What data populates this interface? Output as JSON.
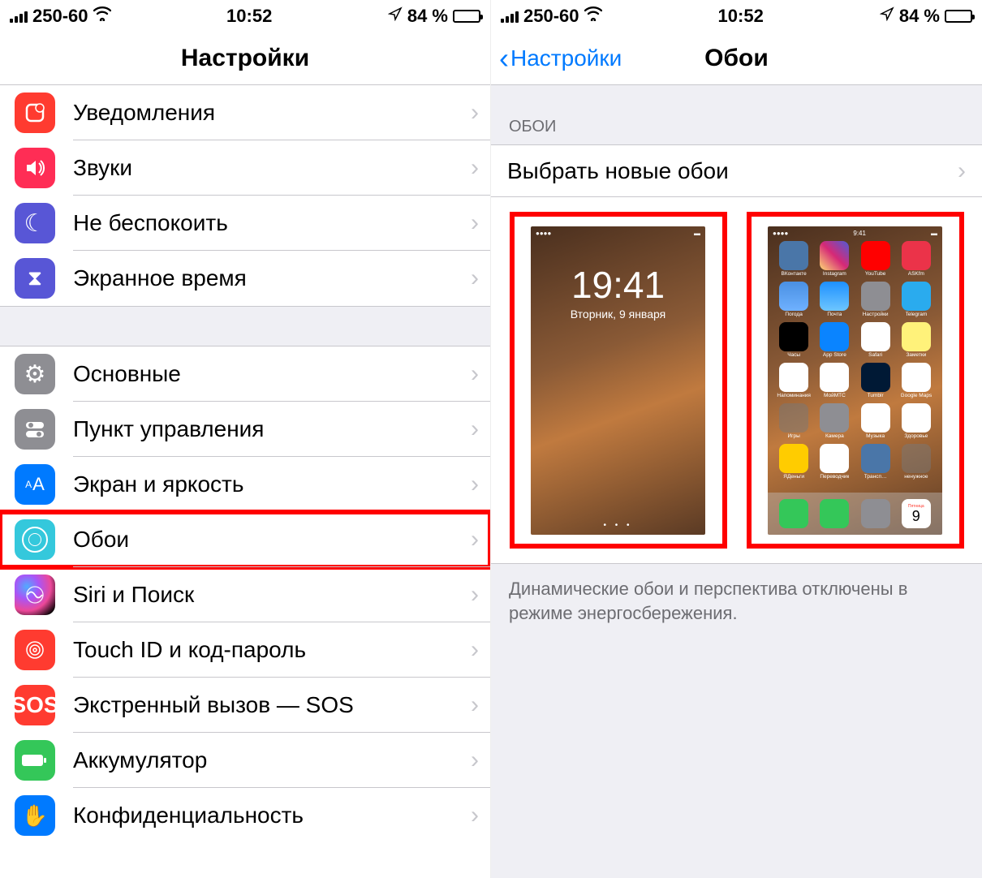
{
  "status": {
    "carrier": "250-60",
    "time": "10:52",
    "battery_pct": "84 %"
  },
  "left": {
    "title": "Настройки",
    "items": [
      {
        "key": "notifications",
        "label": "Уведомления",
        "icon": "notification-icon",
        "color": "ic-red"
      },
      {
        "key": "sounds",
        "label": "Звуки",
        "icon": "speaker-icon",
        "color": "ic-pink"
      },
      {
        "key": "dnd",
        "label": "Не беспокоить",
        "icon": "moon-icon",
        "color": "ic-purple"
      },
      {
        "key": "screentime",
        "label": "Экранное время",
        "icon": "hourglass-icon",
        "color": "ic-purple"
      }
    ],
    "items2": [
      {
        "key": "general",
        "label": "Основные",
        "icon": "gear-icon",
        "color": "ic-gray"
      },
      {
        "key": "controlcenter",
        "label": "Пункт управления",
        "icon": "switches-icon",
        "color": "ic-gray"
      },
      {
        "key": "display",
        "label": "Экран и яркость",
        "icon": "text-size-icon",
        "color": "ic-blue"
      },
      {
        "key": "wallpaper",
        "label": "Обои",
        "icon": "flower-icon",
        "color": "ic-cyan",
        "highlight": true
      },
      {
        "key": "siri",
        "label": "Siri и Поиск",
        "icon": "siri-icon",
        "color": "ic-siri"
      },
      {
        "key": "touchid",
        "label": "Touch ID и код-пароль",
        "icon": "fingerprint-icon",
        "color": "ic-red"
      },
      {
        "key": "sos",
        "label": "Экстренный вызов — SOS",
        "icon": "sos-icon",
        "color": "ic-sos"
      },
      {
        "key": "battery",
        "label": "Аккумулятор",
        "icon": "battery-icon",
        "color": "ic-green"
      },
      {
        "key": "privacy",
        "label": "Конфиденциальность",
        "icon": "hand-icon",
        "color": "ic-blue"
      }
    ]
  },
  "right": {
    "back_label": "Настройки",
    "title": "Обои",
    "section_header": "ОБОИ",
    "choose_new": "Выбрать новые обои",
    "footnote": "Динамические обои и перспектива отключены в режиме энергосбережения.",
    "lock_preview": {
      "time": "19:41",
      "date": "Вторник, 9 января"
    },
    "home_preview": {
      "apps": [
        {
          "label": "ВКонтакте",
          "bg": "#4a76a8"
        },
        {
          "label": "Instagram",
          "bg": "linear-gradient(45deg,#feda75,#d62976,#4f5bd5)"
        },
        {
          "label": "YouTube",
          "bg": "#ff0000"
        },
        {
          "label": "ASKfm",
          "bg": "#eb3349"
        },
        {
          "label": "Погода",
          "bg": "linear-gradient(#4a90e2,#6fb1ff)"
        },
        {
          "label": "Почта",
          "bg": "linear-gradient(#1e90ff,#6ec6ff)"
        },
        {
          "label": "Настройки",
          "bg": "#8e8e93"
        },
        {
          "label": "Telegram",
          "bg": "#2aabee"
        },
        {
          "label": "Часы",
          "bg": "#000"
        },
        {
          "label": "App Store",
          "bg": "#0a84ff"
        },
        {
          "label": "Safari",
          "bg": "#fff"
        },
        {
          "label": "Заметки",
          "bg": "#fff27a"
        },
        {
          "label": "Напоминания",
          "bg": "#fff"
        },
        {
          "label": "МойМТС",
          "bg": "#fff"
        },
        {
          "label": "Tumblr",
          "bg": "#001935"
        },
        {
          "label": "Google Maps",
          "bg": "#fff"
        },
        {
          "label": "Игры",
          "bg": "rgba(120,120,120,.5)"
        },
        {
          "label": "Камера",
          "bg": "#8e8e93"
        },
        {
          "label": "Музыка",
          "bg": "#fff"
        },
        {
          "label": "Здоровье",
          "bg": "#fff"
        },
        {
          "label": "ЯДеньги",
          "bg": "#ffcc00"
        },
        {
          "label": "Переводчик",
          "bg": "#fff"
        },
        {
          "label": "Трансп…",
          "bg": "#4a76a8"
        },
        {
          "label": "ненужное",
          "bg": "rgba(120,120,120,.5)"
        }
      ],
      "dock": [
        {
          "name": "phone",
          "bg": "#34c759"
        },
        {
          "name": "messages",
          "bg": "#34c759"
        },
        {
          "name": "camera",
          "bg": "#8e8e93"
        },
        {
          "name": "calendar",
          "bg": "#fff"
        }
      ],
      "calendar_day": "9",
      "calendar_weekday": "Пятница"
    }
  },
  "glyphs": {
    "notification-icon": "⬜",
    "speaker-icon": "🔊",
    "moon-icon": "☾",
    "hourglass-icon": "⧗",
    "gear-icon": "⚙",
    "switches-icon": "⌬",
    "text-size-icon": "AA",
    "flower-icon": "✢",
    "siri-icon": "◉",
    "fingerprint-icon": "◎",
    "sos-icon": "SOS",
    "battery-icon": "▮",
    "hand-icon": "✋"
  }
}
